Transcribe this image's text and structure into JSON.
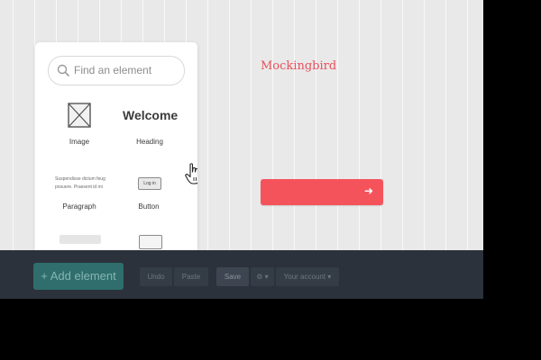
{
  "site": {
    "title": "Mockingbird",
    "cta_arrow": "➜"
  },
  "picker": {
    "search_placeholder": "Find an element",
    "tiles": [
      {
        "label": "Image",
        "icon": "image-placeholder-icon"
      },
      {
        "label": "Heading",
        "sample": "Welcome"
      },
      {
        "label": "Paragraph",
        "sample_lines": [
          "Suspendisse dictum feug",
          "posuere. Praesent id mi"
        ]
      },
      {
        "label": "Button",
        "sample": "Log in"
      }
    ]
  },
  "toolbar": {
    "add_element_label": "+ Add element",
    "undo_label": "Undo",
    "paste_label": "Paste",
    "save_label": "Save",
    "gear_label": "⚙ ▾",
    "account_label": "Your account ▾"
  },
  "colors": {
    "accent": "#f5535b",
    "toolbar_bg": "#2b323b",
    "add_button_bg": "#2f6e6c",
    "canvas_bg": "#e9e9e9"
  }
}
